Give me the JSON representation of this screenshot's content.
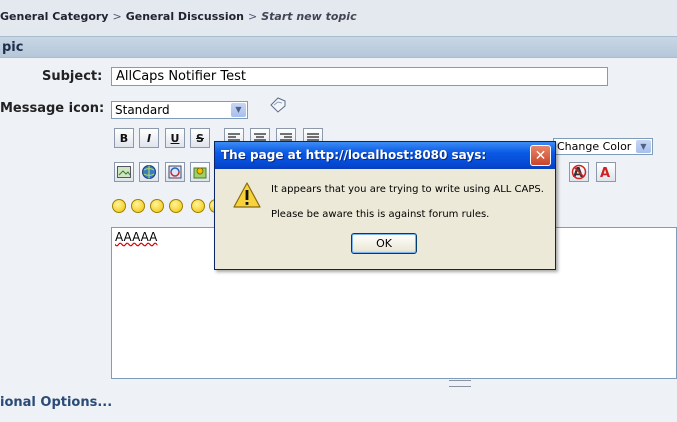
{
  "breadcrumb": {
    "category": "General Category",
    "forum": "General Discussion",
    "current": "Start new topic",
    "separator": ">"
  },
  "header": {
    "title": "pic"
  },
  "form": {
    "subject_label": "Subject:",
    "subject_value": "AllCaps Notifier Test",
    "icon_label": "Message icon:",
    "icon_select_value": "Standard",
    "color_select_value": "Change Color",
    "format_buttons": [
      "B",
      "I",
      "U",
      "S"
    ],
    "message_text": "AAAAA",
    "additional_options": "ional Options..."
  },
  "dialog": {
    "title": "The page at http://localhost:8080 says:",
    "line1": "It appears that you are trying to write using ALL CAPS.",
    "line2": "Please be aware this is against forum rules.",
    "ok_label": "OK",
    "close_symbol": "✕"
  },
  "colors": {
    "header_bg": "#b5c7d9",
    "titlebar_blue": "#0a5ae6",
    "dialog_bg": "#ece9d8",
    "link_blue": "#2a4a78"
  }
}
